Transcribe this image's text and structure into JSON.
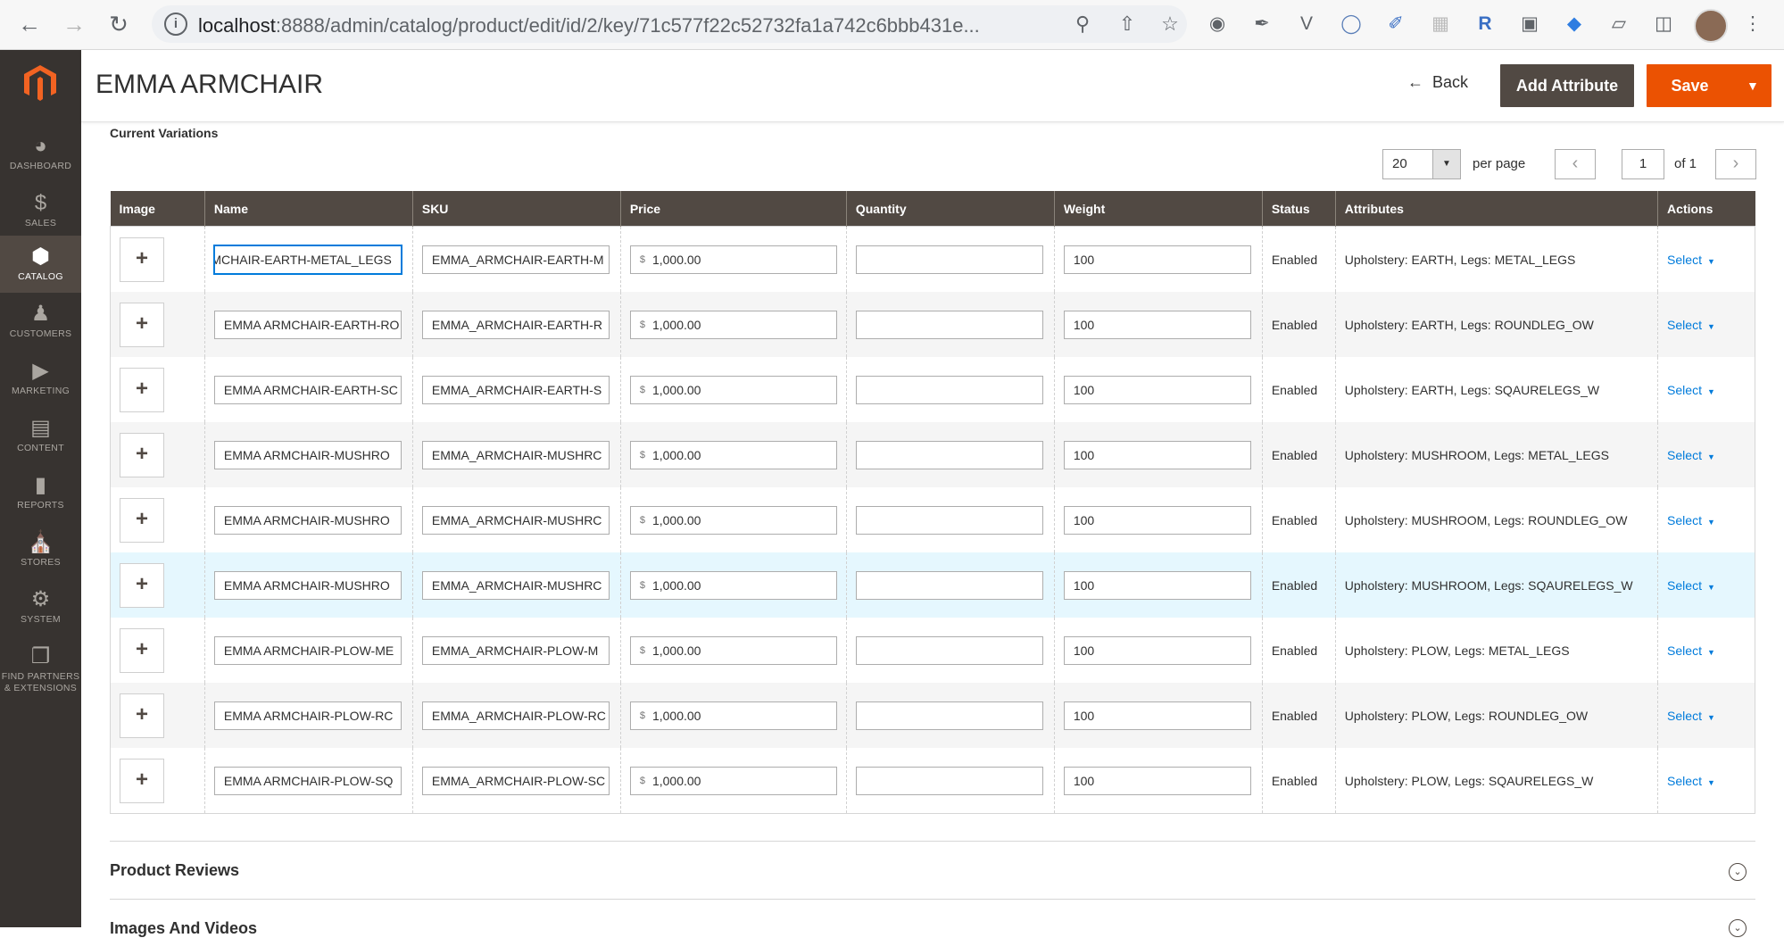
{
  "browser": {
    "url_host": "localhost",
    "url_rest": ":8888/admin/catalog/product/edit/id/2/key/71c577f22c52732fa1a742c6bbb431e..."
  },
  "sidebar": {
    "items": [
      {
        "label": "DASHBOARD",
        "icon": "gauge"
      },
      {
        "label": "SALES",
        "icon": "dollar"
      },
      {
        "label": "CATALOG",
        "icon": "cube",
        "active": true
      },
      {
        "label": "CUSTOMERS",
        "icon": "person"
      },
      {
        "label": "MARKETING",
        "icon": "megaphone"
      },
      {
        "label": "CONTENT",
        "icon": "layout"
      },
      {
        "label": "REPORTS",
        "icon": "bar-chart"
      },
      {
        "label": "STORES",
        "icon": "store"
      },
      {
        "label": "SYSTEM",
        "icon": "gear"
      },
      {
        "label": "FIND PARTNERS & EXTENSIONS",
        "icon": "box"
      }
    ]
  },
  "header": {
    "title": "EMMA ARMCHAIR",
    "back_label": "Back",
    "add_attribute_label": "Add Attribute",
    "save_label": "Save"
  },
  "variations": {
    "section_title": "Current Variations",
    "per_page_value": "20",
    "per_page_label": "per page",
    "page_value": "1",
    "page_of": "of 1",
    "columns": [
      "Image",
      "Name",
      "SKU",
      "Price",
      "Quantity",
      "Weight",
      "Status",
      "Attributes",
      "Actions"
    ],
    "rows": [
      {
        "name": "MCHAIR-EARTH-METAL_LEGS",
        "sku": "EMMA_ARMCHAIR-EARTH-M",
        "currency": "$",
        "price": "1,000.00",
        "quantity": "",
        "weight": "100",
        "status": "Enabled",
        "attributes": "Upholstery: EARTH, Legs: METAL_LEGS",
        "action": "Select"
      },
      {
        "name": "EMMA ARMCHAIR-EARTH-RO",
        "sku": "EMMA_ARMCHAIR-EARTH-R",
        "currency": "$",
        "price": "1,000.00",
        "quantity": "",
        "weight": "100",
        "status": "Enabled",
        "attributes": "Upholstery: EARTH, Legs: ROUNDLEG_OW",
        "action": "Select"
      },
      {
        "name": "EMMA ARMCHAIR-EARTH-SC",
        "sku": "EMMA_ARMCHAIR-EARTH-S",
        "currency": "$",
        "price": "1,000.00",
        "quantity": "",
        "weight": "100",
        "status": "Enabled",
        "attributes": "Upholstery: EARTH, Legs: SQAURELEGS_W",
        "action": "Select"
      },
      {
        "name": "EMMA ARMCHAIR-MUSHRO",
        "sku": "EMMA_ARMCHAIR-MUSHRC",
        "currency": "$",
        "price": "1,000.00",
        "quantity": "",
        "weight": "100",
        "status": "Enabled",
        "attributes": "Upholstery: MUSHROOM, Legs: METAL_LEGS",
        "action": "Select"
      },
      {
        "name": "EMMA ARMCHAIR-MUSHRO",
        "sku": "EMMA_ARMCHAIR-MUSHRC",
        "currency": "$",
        "price": "1,000.00",
        "quantity": "",
        "weight": "100",
        "status": "Enabled",
        "attributes": "Upholstery: MUSHROOM, Legs: ROUNDLEG_OW",
        "action": "Select"
      },
      {
        "name": "EMMA ARMCHAIR-MUSHRO",
        "sku": "EMMA_ARMCHAIR-MUSHRC",
        "currency": "$",
        "price": "1,000.00",
        "quantity": "",
        "weight": "100",
        "status": "Enabled",
        "attributes": "Upholstery: MUSHROOM, Legs: SQAURELEGS_W",
        "action": "Select"
      },
      {
        "name": "EMMA ARMCHAIR-PLOW-ME",
        "sku": "EMMA_ARMCHAIR-PLOW-M",
        "currency": "$",
        "price": "1,000.00",
        "quantity": "",
        "weight": "100",
        "status": "Enabled",
        "attributes": "Upholstery: PLOW, Legs: METAL_LEGS",
        "action": "Select"
      },
      {
        "name": "EMMA ARMCHAIR-PLOW-RC",
        "sku": "EMMA_ARMCHAIR-PLOW-RC",
        "currency": "$",
        "price": "1,000.00",
        "quantity": "",
        "weight": "100",
        "status": "Enabled",
        "attributes": "Upholstery: PLOW, Legs: ROUNDLEG_OW",
        "action": "Select"
      },
      {
        "name": "EMMA ARMCHAIR-PLOW-SQ",
        "sku": "EMMA_ARMCHAIR-PLOW-SC",
        "currency": "$",
        "price": "1,000.00",
        "quantity": "",
        "weight": "100",
        "status": "Enabled",
        "attributes": "Upholstery: PLOW, Legs: SQAURELEGS_W",
        "action": "Select"
      }
    ]
  },
  "sections": {
    "product_reviews": "Product Reviews",
    "images_videos": "Images And Videos"
  },
  "colors": {
    "accent": "#eb5202",
    "sidebar": "#373330",
    "header_row": "#514943",
    "link": "#007bdb"
  }
}
